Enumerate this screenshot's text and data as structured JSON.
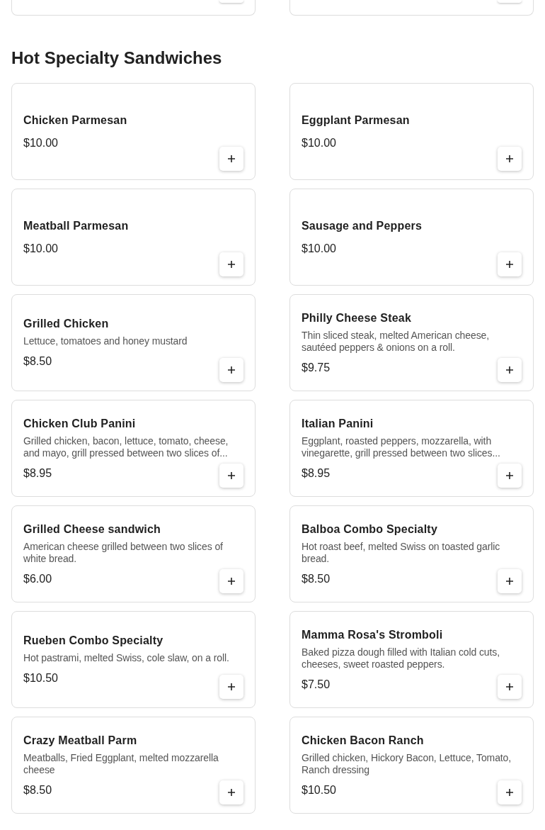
{
  "section": {
    "title": "Hot Specialty Sandwiches",
    "items": [
      {
        "name": "Chicken Parmesan",
        "price": "$10.00"
      },
      {
        "name": "Eggplant Parmesan",
        "price": "$10.00"
      },
      {
        "name": "Meatball Parmesan",
        "price": "$10.00"
      },
      {
        "name": "Sausage and Peppers",
        "price": "$10.00"
      },
      {
        "name": "Grilled Chicken",
        "description": "Lettuce, tomatoes and honey mustard",
        "price": "$8.50"
      },
      {
        "name": "Philly Cheese Steak",
        "description": "Thin sliced steak, melted American cheese, sautéed peppers & onions on a roll.",
        "price": "$9.75"
      },
      {
        "name": "Chicken Club Panini",
        "description": "Grilled chicken, bacon, lettuce, tomato, cheese, and mayo, grill pressed between two slices of...",
        "price": "$8.95"
      },
      {
        "name": "Italian Panini",
        "description": "Eggplant, roasted peppers, mozzarella, with vinegarette, grill pressed between two slices...",
        "price": "$8.95"
      },
      {
        "name": "Grilled Cheese sandwich",
        "description": "American cheese grilled between two slices of white bread.",
        "price": "$6.00"
      },
      {
        "name": "Balboa Combo Specialty",
        "description": "Hot roast beef, melted Swiss on toasted garlic bread.",
        "price": "$8.50"
      },
      {
        "name": "Rueben Combo Specialty",
        "description": "Hot pastrami, melted Swiss, cole slaw, on a roll.",
        "price": "$10.50"
      },
      {
        "name": "Mamma Rosa's Stromboli",
        "description": "Baked pizza dough filled with Italian cold cuts, cheeses, sweet roasted peppers.",
        "price": "$7.50"
      },
      {
        "name": "Crazy Meatball Parm",
        "description": "Meatballs, Fried Eggplant, melted mozzarella cheese",
        "price": "$8.50"
      },
      {
        "name": "Chicken Bacon Ranch",
        "description": "Grilled chicken, Hickory Bacon, Lettuce, Tomato, Ranch dressing",
        "price": "$10.50"
      }
    ]
  }
}
